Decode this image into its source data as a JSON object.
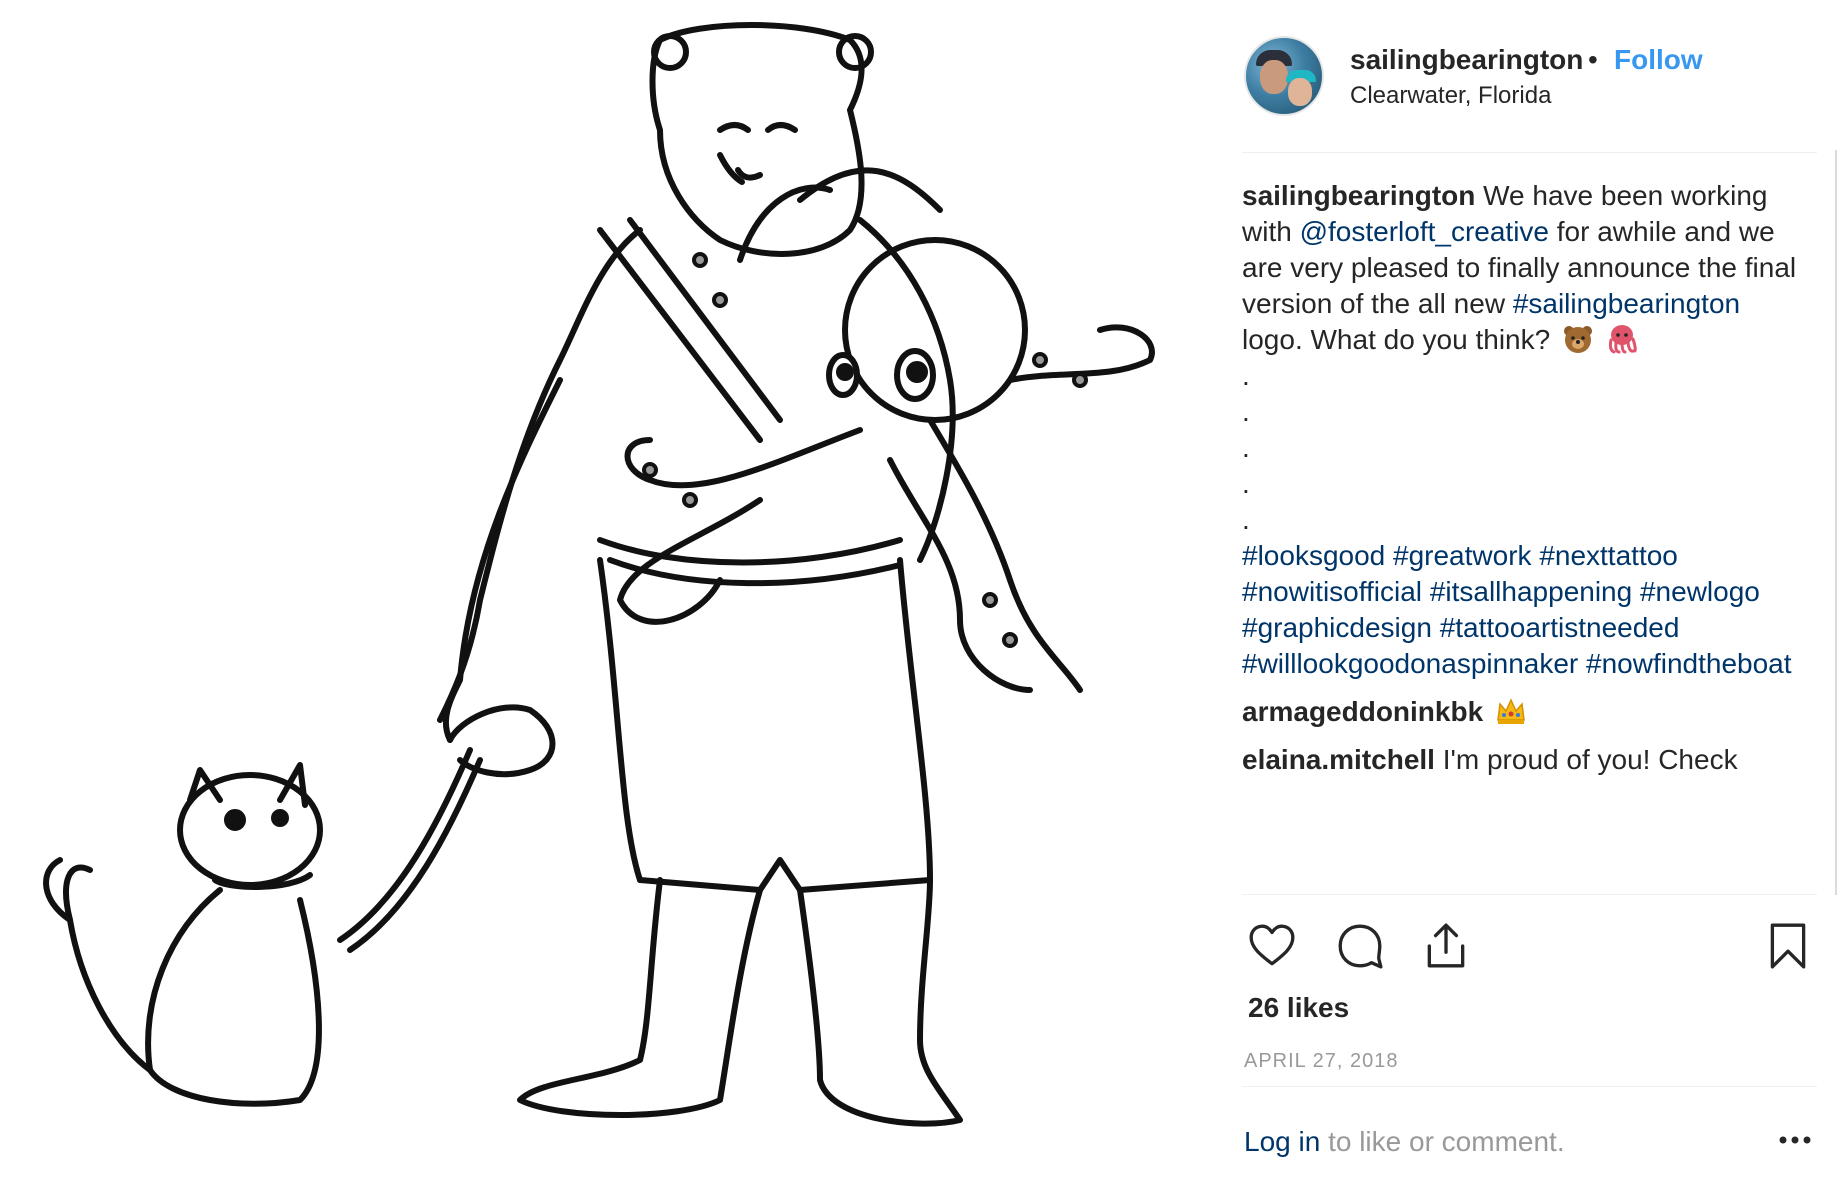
{
  "post": {
    "image_alt": "",
    "header": {
      "username": "sailingbearington",
      "separator": "•",
      "follow_label": "Follow",
      "location": "Clearwater, Florida"
    },
    "caption": {
      "username": "sailingbearington",
      "text_1": " We have been working with ",
      "mention": "@fosterloft_creative",
      "text_2": " for awhile and we are very pleased to finally announce the final version of the all new ",
      "hashtag_main": "#sailingbearington",
      "text_3": " logo. What do you think?",
      "dots": [
        ".",
        ".",
        ".",
        ".",
        "."
      ],
      "hashtags": [
        "#looksgood",
        "#greatwork",
        "#nexttattoo",
        "#nowitisofficial",
        "#itsallhappening",
        "#newlogo",
        "#graphicdesign",
        "#tattooartistneeded",
        "#willlookgoodonaspinnaker",
        "#nowfindtheboat"
      ]
    },
    "comments": [
      {
        "username": "armageddoninkbk",
        "text": "",
        "emoji": "crown-emoji"
      },
      {
        "username": "elaina.mitchell",
        "text": " I'm proud of you! Check"
      }
    ],
    "actions": {
      "like_icon": "heart-icon",
      "comment_icon": "speech-bubble-icon",
      "share_icon": "share-icon",
      "save_icon": "bookmark-icon"
    },
    "likes": "26 likes",
    "date": "APRIL 27, 2018",
    "login": {
      "link": "Log in",
      "text": " to like or comment."
    },
    "more_icon": "ellipsis-icon"
  },
  "colors": {
    "link": "#003569",
    "follow": "#3897f0",
    "muted": "#999999",
    "divider": "#efefef"
  }
}
